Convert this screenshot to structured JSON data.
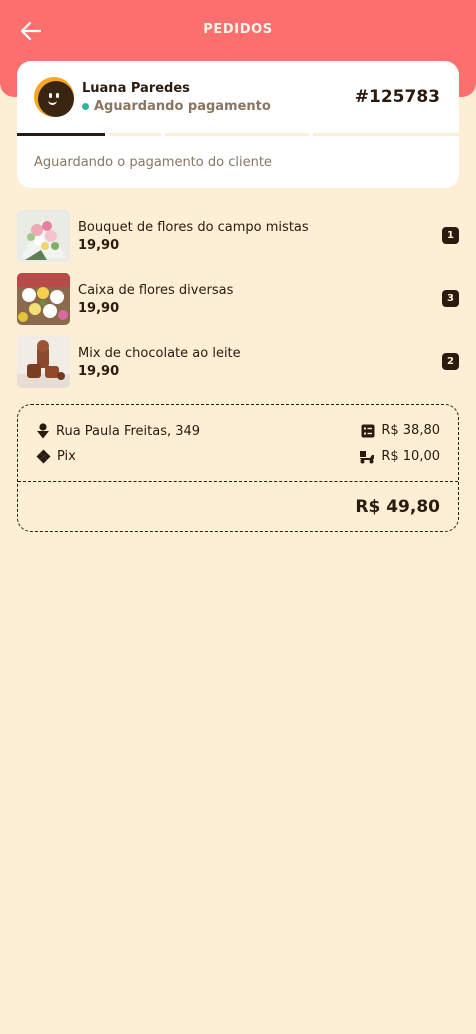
{
  "header": {
    "title": "PEDIDOS",
    "back_icon": "arrow-left-icon",
    "color": "#fb6f6e"
  },
  "order": {
    "customer_name": "Luana Paredes",
    "status": "Aguardando pagamento",
    "status_color": "#2bb5a0",
    "number": "#125783",
    "status_message": "Aguardando o pagamento do cliente",
    "progress_step": 1,
    "progress_total": 4
  },
  "items": [
    {
      "name": "Bouquet de flores do campo mistas",
      "price": "19,90",
      "quantity": "1"
    },
    {
      "name": "Caixa de flores diversas",
      "price": "19,90",
      "quantity": "3"
    },
    {
      "name": "Mix de chocolate ao leite",
      "price": "19,90",
      "quantity": "2"
    }
  ],
  "summary": {
    "address": "Rua Paula Freitas, 349",
    "address_icon": "location-pin-icon",
    "payment_method": "Pix",
    "payment_icon": "pix-icon",
    "subtotal": "R$ 38,80",
    "subtotal_icon": "receipt-icon",
    "delivery_fee": "R$ 10,00",
    "delivery_icon": "delivery-scooter-icon",
    "total": "R$ 49,80"
  }
}
